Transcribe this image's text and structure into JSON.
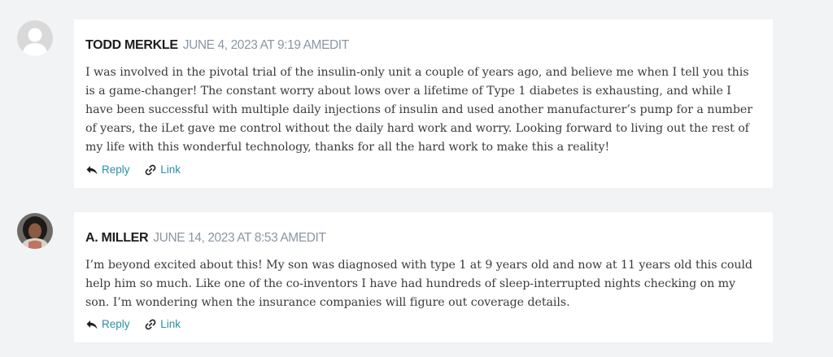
{
  "comments": [
    {
      "author": "TODD MERKLE",
      "date": "JUNE 4, 2023 AT 9:19 AM",
      "edit_label": "EDIT",
      "text": "I was involved in the pivotal trial of the insulin-only unit a couple of years ago, and believe me when I tell you this is a game-changer! The constant worry about lows over a lifetime of Type 1 diabetes is exhausting, and while I have been successful with multiple daily injections of insulin and used another manufacturer’s pump for a number of years, the iLet gave me control without the daily hard work and worry. Looking forward to living out the rest of my life with this wonderful technology, thanks for all the hard work to make this a reality!",
      "reply_label": "Reply",
      "link_label": "Link",
      "avatar": "default-avatar-icon"
    },
    {
      "author": "A. MILLER",
      "date": "JUNE 14, 2023 AT 8:53 AM",
      "edit_label": "EDIT",
      "text": "I’m beyond excited about this! My son was diagnosed with type 1 at 9 years old and now at 11 years old this could help him so much. Like one of the co-inventors I have had hundreds of sleep-interrupted nights checking on my son. I’m wondering when the insurance companies will figure out coverage details.",
      "reply_label": "Reply",
      "link_label": "Link",
      "avatar": "user-photo-avatar"
    }
  ],
  "colors": {
    "background": "#f2f3f5",
    "card": "#ffffff",
    "author": "#1d1d1d",
    "meta": "#8a97a3",
    "body_text": "#3b3b3b",
    "link": "#2a8fa6"
  }
}
